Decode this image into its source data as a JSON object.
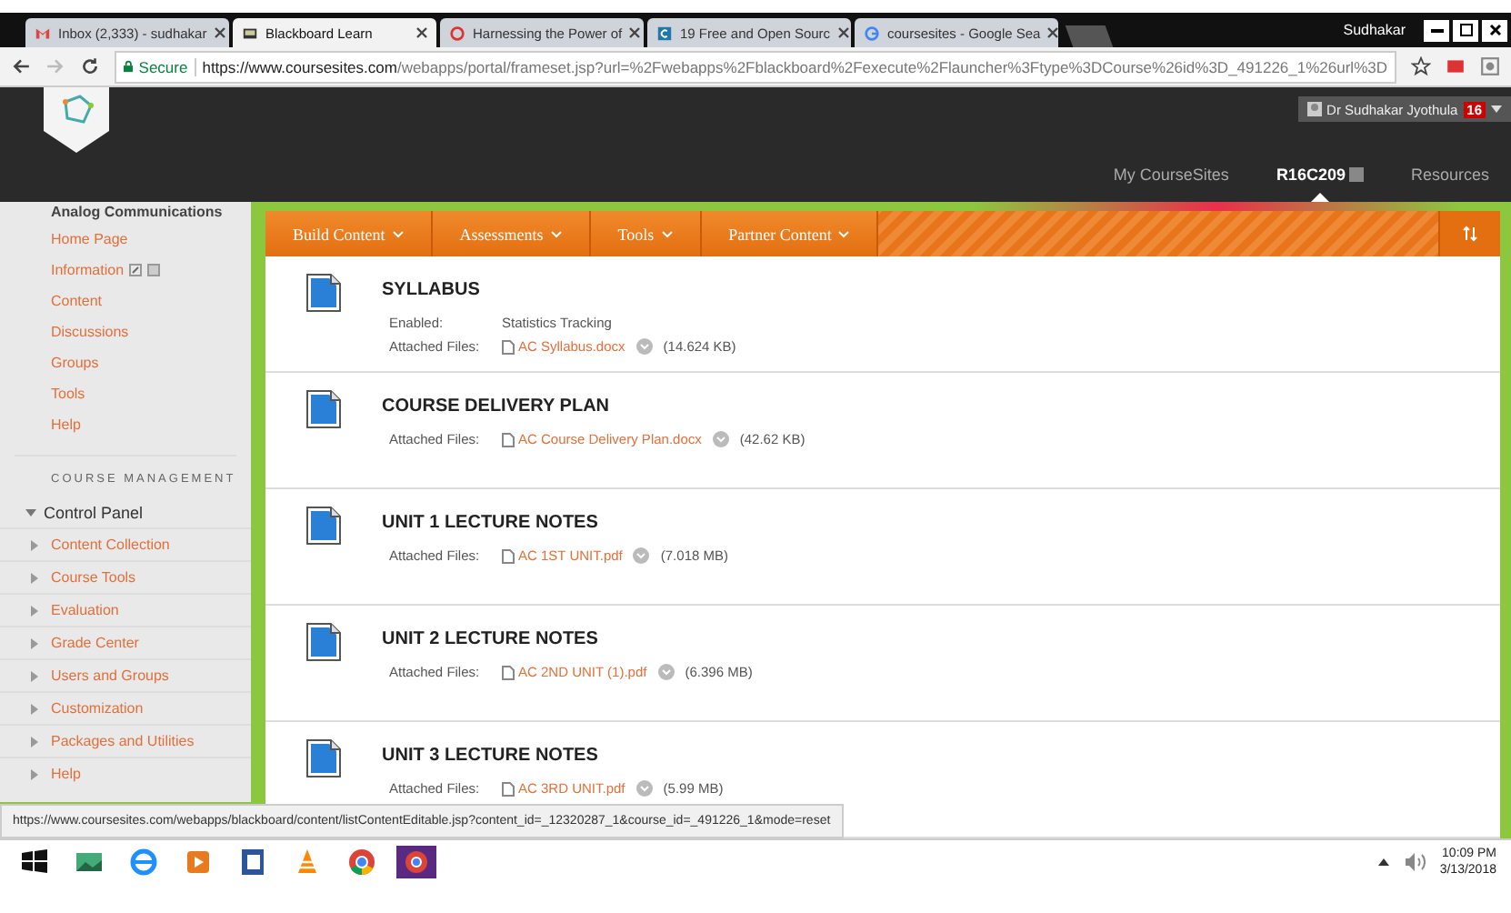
{
  "browser": {
    "tabs": [
      {
        "title": "Inbox (2,333) - sudhakar",
        "selected": false
      },
      {
        "title": "Blackboard Learn",
        "selected": true
      },
      {
        "title": "Harnessing the Power of",
        "selected": false
      },
      {
        "title": "19 Free and Open Sourc",
        "selected": false
      },
      {
        "title": "coursesites - Google Sea",
        "selected": false
      }
    ],
    "profile": "Sudhakar",
    "secure": "Secure",
    "url_host": "https://www.coursesites.com",
    "url_path": "/webapps/portal/frameset.jsp?url=%2Fwebapps%2Fblackboard%2Fexecute%2Flauncher%3Ftype%3DCourse%26id%3D_491226_1%26url%3D"
  },
  "header": {
    "user": "Dr Sudhakar Jyothula",
    "badge": "16",
    "nav": [
      {
        "label": "My CourseSites",
        "selected": false
      },
      {
        "label": "R16C209",
        "selected": true
      },
      {
        "label": "Resources",
        "selected": false
      }
    ]
  },
  "sidebar": {
    "course_title": "Analog Communications",
    "links": [
      {
        "label": "Home Page"
      },
      {
        "label": "Information",
        "kind": "editable"
      },
      {
        "label": "Content"
      },
      {
        "label": "Discussions"
      },
      {
        "label": "Groups"
      },
      {
        "label": "Tools"
      },
      {
        "label": "Help"
      }
    ],
    "section_title": "COURSE MANAGEMENT",
    "control_panel": {
      "label": "Control Panel",
      "expanded": true,
      "children": [
        {
          "label": "Content Collection"
        },
        {
          "label": "Course Tools"
        },
        {
          "label": "Evaluation"
        },
        {
          "label": "Grade Center"
        },
        {
          "label": "Users and Groups"
        },
        {
          "label": "Customization"
        },
        {
          "label": "Packages and Utilities"
        },
        {
          "label": "Help"
        }
      ]
    }
  },
  "action_bar": {
    "menus": [
      "Build Content",
      "Assessments",
      "Tools",
      "Partner Content"
    ]
  },
  "items": [
    {
      "title": "SYLLABUS",
      "enabled_label": "Enabled:",
      "enabled_value": "Statistics Tracking",
      "files_label": "Attached Files:",
      "file": "AC Syllabus.docx",
      "size": "(14.624 KB)"
    },
    {
      "title": "COURSE DELIVERY PLAN",
      "files_label": "Attached Files:",
      "file": "AC Course Delivery Plan.docx",
      "size": "(42.62 KB)"
    },
    {
      "title": "UNIT 1 LECTURE NOTES",
      "files_label": "Attached Files:",
      "file": "AC 1ST UNIT.pdf",
      "size": "(7.018 MB)"
    },
    {
      "title": "UNIT 2 LECTURE NOTES",
      "files_label": "Attached Files:",
      "file": "AC 2ND UNIT (1).pdf",
      "size": "(6.396 MB)"
    },
    {
      "title": "UNIT 3 LECTURE NOTES",
      "files_label": "Attached Files:",
      "file": "AC 3RD UNIT.pdf",
      "size": "(5.99 MB)"
    }
  ],
  "status_url": "https://www.coursesites.com/webapps/blackboard/content/listContentEditable.jsp?content_id=_12320287_1&course_id=_491226_1&mode=reset",
  "taskbar": {
    "time": "10:09 PM",
    "date": "3/13/2018"
  }
}
